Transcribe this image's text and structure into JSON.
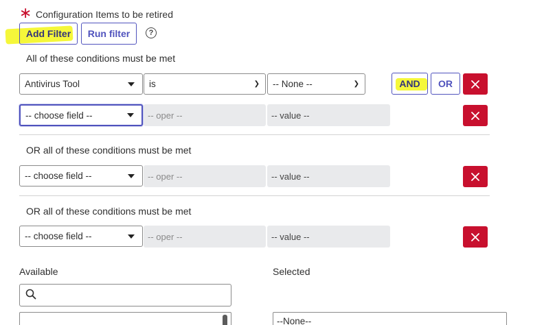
{
  "header": {
    "required_marker": "∗",
    "title": "Configuration Items to be retired"
  },
  "toolbar": {
    "add_filter_label": "Add Filter",
    "run_filter_label": "Run filter",
    "help_icon": "question-circle-icon",
    "help_glyph": "?"
  },
  "groups": [
    {
      "heading": "All of these conditions must be met",
      "rows": [
        {
          "field": "Antivirus Tool",
          "operator": "is",
          "value": "-- None --",
          "and_label": "AND",
          "or_label": "OR"
        },
        {
          "field": "-- choose field --",
          "operator": "-- oper --",
          "value": "-- value --"
        }
      ]
    },
    {
      "heading": "OR all of these conditions must be met",
      "rows": [
        {
          "field": "-- choose field --",
          "operator": "-- oper --",
          "value": "-- value --"
        }
      ]
    },
    {
      "heading": "OR all of these conditions must be met",
      "rows": [
        {
          "field": "-- choose field --",
          "operator": "-- oper --",
          "value": "-- value --"
        }
      ]
    }
  ],
  "slushbucket": {
    "available_label": "Available",
    "selected_label": "Selected",
    "search_placeholder": "",
    "selected_items": [
      "--None--"
    ]
  },
  "colors": {
    "accent": "#4f52bd",
    "danger": "#c8102e",
    "highlight": "#f5f73a"
  }
}
